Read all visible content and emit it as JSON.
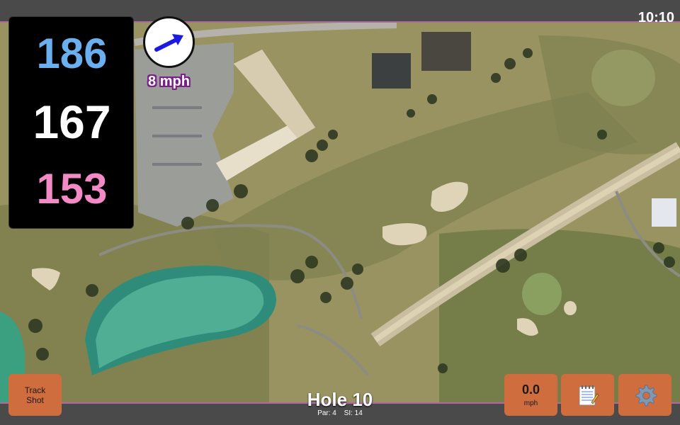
{
  "status_bar": {
    "time": "10:10"
  },
  "yardages": {
    "back": "186",
    "middle": "167",
    "front": "153"
  },
  "wind": {
    "speed": "8 mph",
    "icon": "wind-direction-arrow-icon"
  },
  "buttons": {
    "track_shot_line1": "Track",
    "track_shot_line2": "Shot",
    "speed_value": "0.0",
    "speed_unit": "mph",
    "notes_icon": "notepad-icon",
    "settings_icon": "gear-icon"
  },
  "hole": {
    "title": "Hole 10",
    "par": "Par: 4",
    "stroke_index": "SI: 14"
  },
  "colors": {
    "back": "#6ab0f0",
    "middle": "#ffffff",
    "front": "#f28ac6",
    "button": "#cf6d3e"
  }
}
